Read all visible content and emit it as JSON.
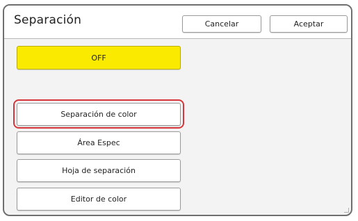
{
  "header": {
    "title": "Separación",
    "cancel_label": "Cancelar",
    "accept_label": "Aceptar"
  },
  "mode": {
    "off_label": "OFF",
    "off_color": "#f9ea00"
  },
  "options": {
    "items": [
      {
        "label": "Separación de color",
        "selected": true
      },
      {
        "label": "Área Espec",
        "selected": false
      },
      {
        "label": "Hoja de separación",
        "selected": false
      },
      {
        "label": "Editor de color",
        "selected": false
      }
    ]
  },
  "colors": {
    "selection_ring": "#d6363b",
    "panel_bg": "#f3f3f3"
  }
}
